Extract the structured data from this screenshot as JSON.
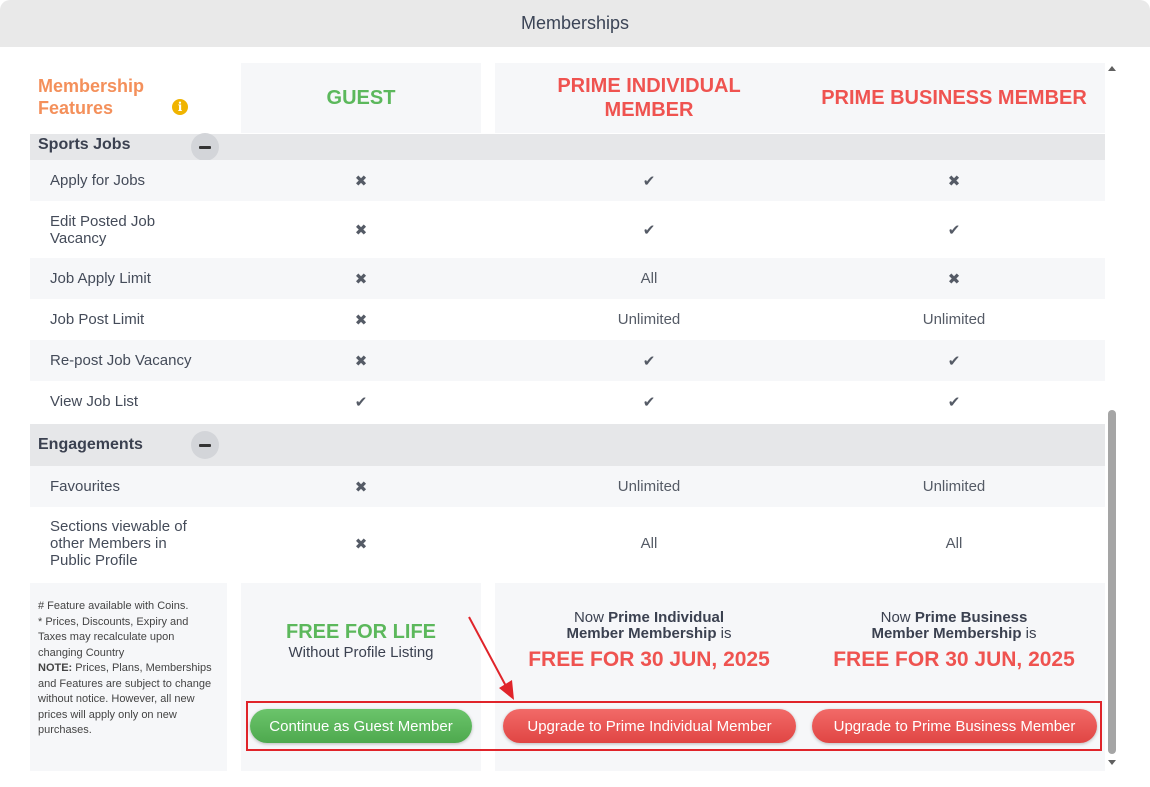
{
  "window": {
    "title": "Memberships"
  },
  "header": {
    "features_label": "Membership Features",
    "info_icon": "i",
    "columns": [
      "GUEST",
      "PRIME INDIVIDUAL MEMBER",
      "PRIME BUSINESS MEMBER"
    ]
  },
  "sections": [
    {
      "title": "Sports Jobs",
      "rows": [
        {
          "feature": "Apply for Jobs",
          "values": [
            "x",
            "check",
            "x"
          ]
        },
        {
          "feature": "Edit Posted Job Vacancy",
          "values": [
            "x",
            "check",
            "check"
          ]
        },
        {
          "feature": "Job Apply Limit",
          "values": [
            "x",
            "All",
            "x"
          ]
        },
        {
          "feature": "Job Post Limit",
          "values": [
            "x",
            "Unlimited",
            "Unlimited"
          ]
        },
        {
          "feature": "Re-post Job Vacancy",
          "values": [
            "x",
            "check",
            "check"
          ]
        },
        {
          "feature": "View Job List",
          "values": [
            "check",
            "check",
            "check"
          ]
        }
      ]
    },
    {
      "title": "Engagements",
      "rows": [
        {
          "feature": "Favourites",
          "values": [
            "x",
            "Unlimited",
            "Unlimited"
          ]
        },
        {
          "feature": "Sections viewable of other Members in Public Profile",
          "values": [
            "x",
            "All",
            "All"
          ]
        }
      ]
    }
  ],
  "notes": {
    "line1": "# Feature available with Coins.",
    "line2": "* Prices, Discounts, Expiry and Taxes may recalculate upon changing Country",
    "note_label": "NOTE:",
    "note_text": " Prices, Plans, Memberships and Features are subject to change without notice. However, all new prices will apply only on new purchases."
  },
  "guest_offer": {
    "headline": "FREE FOR LIFE",
    "sub": "Without Profile Listing"
  },
  "individual_offer": {
    "prefix": "Now ",
    "plan": "Prime Individual Member Membership",
    "suffix": " is",
    "free": "FREE FOR 30 JUN, 2025"
  },
  "business_offer": {
    "prefix": "Now ",
    "plan": "Prime Business Member Membership",
    "suffix": " is",
    "free": "FREE FOR 30 JUN, 2025"
  },
  "buttons": {
    "guest": "Continue as Guest Member",
    "individual": "Upgrade to Prime Individual Member",
    "business": "Upgrade to Prime Business Member"
  },
  "icons": {
    "x": "✖",
    "check": "✔",
    "scroll_up": "caret-up-icon",
    "scroll_down": "caret-down-icon"
  },
  "colors": {
    "guest": "#5cb85c",
    "prime": "#ef5350",
    "features": "#f4905b",
    "highlight": "#e0242a"
  }
}
